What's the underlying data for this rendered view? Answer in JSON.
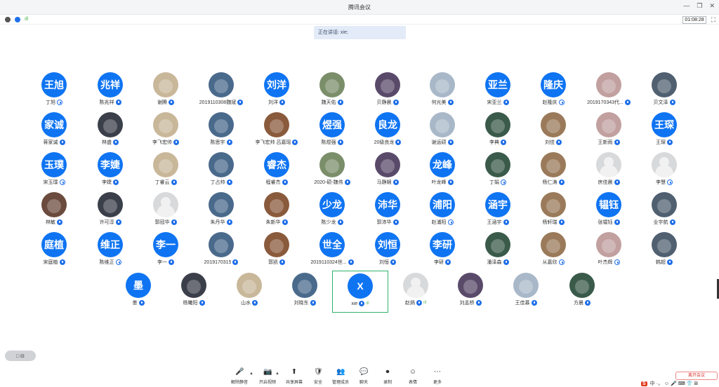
{
  "window": {
    "title": "腾讯会议"
  },
  "toolbar": {
    "time": "01:08:28"
  },
  "speaking": {
    "text": "正在讲话: xie;"
  },
  "colors": {
    "accent": "#0f74f2",
    "selected_border": "#2fb26b"
  },
  "participants": [
    {
      "kind": "blue",
      "avatar": "王旭",
      "name": "丁旭",
      "mic": "off"
    },
    {
      "kind": "blue",
      "avatar": "兆祥",
      "name": "陈兆祥",
      "mic": "on"
    },
    {
      "kind": "photo",
      "avatar": "",
      "name": "谢腾",
      "mic": "on"
    },
    {
      "kind": "photo",
      "avatar": "",
      "name": "2019110308魏斌",
      "mic": "on"
    },
    {
      "kind": "blue",
      "avatar": "刘洋",
      "name": "刘洋",
      "mic": "on"
    },
    {
      "kind": "photo",
      "avatar": "",
      "name": "魏天佑",
      "mic": "on"
    },
    {
      "kind": "photo",
      "avatar": "",
      "name": "贝静晨",
      "mic": "on"
    },
    {
      "kind": "photo",
      "avatar": "",
      "name": "何光美",
      "mic": "on"
    },
    {
      "kind": "blue",
      "avatar": "亚兰",
      "name": "宋亚兰",
      "mic": "on"
    },
    {
      "kind": "blue",
      "avatar": "隆庆",
      "name": "赵隆庆",
      "mic": "off"
    },
    {
      "kind": "photo",
      "avatar": "",
      "name": "2019170343代...",
      "mic": "on"
    },
    {
      "kind": "photo",
      "avatar": "",
      "name": "贝文泽",
      "mic": "on"
    },
    {
      "kind": "blue",
      "avatar": "家诚",
      "name": "蒋家诚",
      "mic": "on"
    },
    {
      "kind": "photo",
      "avatar": "",
      "name": "林盛",
      "mic": "on"
    },
    {
      "kind": "photo",
      "avatar": "",
      "name": "李飞宏帅",
      "mic": "on"
    },
    {
      "kind": "photo",
      "avatar": "",
      "name": "陈思宇",
      "mic": "on"
    },
    {
      "kind": "photo",
      "avatar": "",
      "name": "李飞宏帅 吕嘉瑶",
      "mic": "on"
    },
    {
      "kind": "blue",
      "avatar": "煜强",
      "name": "陈煜强",
      "mic": "on"
    },
    {
      "kind": "blue",
      "avatar": "良龙",
      "name": "20级良龙",
      "mic": "on"
    },
    {
      "kind": "photo",
      "avatar": "",
      "name": "谢运硕",
      "mic": "on"
    },
    {
      "kind": "photo",
      "avatar": "",
      "name": "李典",
      "mic": "on"
    },
    {
      "kind": "photo",
      "avatar": "",
      "name": "刘佳",
      "mic": "on"
    },
    {
      "kind": "photo",
      "avatar": "",
      "name": "王新雨",
      "mic": "on"
    },
    {
      "kind": "blue",
      "avatar": "王琛",
      "name": "王琛",
      "mic": "on"
    },
    {
      "kind": "blue",
      "avatar": "玉璞",
      "name": "宋玉璞",
      "mic": "off"
    },
    {
      "kind": "blue",
      "avatar": "李婕",
      "name": "李婕",
      "mic": "on"
    },
    {
      "kind": "photo",
      "avatar": "",
      "name": "丁睿云",
      "mic": "on"
    },
    {
      "kind": "photo",
      "avatar": "",
      "name": "丁占帅",
      "mic": "on"
    },
    {
      "kind": "blue",
      "avatar": "睿杰",
      "name": "程睿杰",
      "mic": "on"
    },
    {
      "kind": "photo",
      "avatar": "",
      "name": "2020-硕-魏伟",
      "mic": "on"
    },
    {
      "kind": "photo",
      "avatar": "",
      "name": "马静娴",
      "mic": "on"
    },
    {
      "kind": "blue",
      "avatar": "龙峰",
      "name": "叶龙峰",
      "mic": "on"
    },
    {
      "kind": "photo",
      "avatar": "",
      "name": "丁娟",
      "mic": "off"
    },
    {
      "kind": "photo",
      "avatar": "",
      "name": "杨仁涛",
      "mic": "on"
    },
    {
      "kind": "grey",
      "avatar": "",
      "name": "房佳晨",
      "mic": "on"
    },
    {
      "kind": "grey",
      "avatar": "",
      "name": "李慧",
      "mic": "off"
    },
    {
      "kind": "photo",
      "avatar": "",
      "name": "林敏",
      "mic": "on"
    },
    {
      "kind": "photo",
      "avatar": "",
      "name": "许可淳",
      "mic": "on"
    },
    {
      "kind": "grey",
      "avatar": "",
      "name": "郭冠华",
      "mic": "on"
    },
    {
      "kind": "photo",
      "avatar": "",
      "name": "朱丹华",
      "mic": "on"
    },
    {
      "kind": "photo",
      "avatar": "",
      "name": "朱新华",
      "mic": "on"
    },
    {
      "kind": "blue",
      "avatar": "少龙",
      "name": "陈少龙",
      "mic": "on"
    },
    {
      "kind": "blue",
      "avatar": "沛华",
      "name": "郭沛华",
      "mic": "on"
    },
    {
      "kind": "blue",
      "avatar": "浦阳",
      "name": "赵浦阳",
      "mic": "off"
    },
    {
      "kind": "blue",
      "avatar": "涵宇",
      "name": "王涵宇",
      "mic": "on"
    },
    {
      "kind": "photo",
      "avatar": "",
      "name": "杨轩瑞",
      "mic": "on"
    },
    {
      "kind": "blue",
      "avatar": "韫钰",
      "name": "张韫钰",
      "mic": "on"
    },
    {
      "kind": "photo",
      "avatar": "",
      "name": "业宇航",
      "mic": "on"
    },
    {
      "kind": "blue",
      "avatar": "庭植",
      "name": "宋庭植",
      "mic": "on"
    },
    {
      "kind": "blue",
      "avatar": "维正",
      "name": "陈维正",
      "mic": "off"
    },
    {
      "kind": "blue",
      "avatar": "李一",
      "name": "李一",
      "mic": "on"
    },
    {
      "kind": "photo",
      "avatar": "",
      "name": "2019170315",
      "mic": "on"
    },
    {
      "kind": "photo",
      "avatar": "",
      "name": "郭凯",
      "mic": "on"
    },
    {
      "kind": "blue",
      "avatar": "世全",
      "name": "2019110324世...",
      "mic": "on"
    },
    {
      "kind": "blue",
      "avatar": "刘恒",
      "name": "刘恒",
      "mic": "on"
    },
    {
      "kind": "blue",
      "avatar": "李研",
      "name": "李研",
      "mic": "on"
    },
    {
      "kind": "photo",
      "avatar": "",
      "name": "潘泽森",
      "mic": "on"
    },
    {
      "kind": "photo",
      "avatar": "",
      "name": "从嘉欣",
      "mic": "off"
    },
    {
      "kind": "photo",
      "avatar": "",
      "name": "叶杰辉",
      "mic": "off"
    },
    {
      "kind": "photo",
      "avatar": "",
      "name": "韩超",
      "mic": "on"
    },
    {
      "kind": "blue",
      "avatar": "墨",
      "name": "墨",
      "mic": "on"
    },
    {
      "kind": "photo",
      "avatar": "",
      "name": "杨曦阳",
      "mic": "on"
    },
    {
      "kind": "photo",
      "avatar": "",
      "name": "山水",
      "mic": "on"
    },
    {
      "kind": "photo",
      "avatar": "",
      "name": "刘晓东",
      "mic": "on"
    },
    {
      "kind": "blue",
      "avatar": "X",
      "name": "xie",
      "mic": "on",
      "selected": true,
      "bars": true
    },
    {
      "kind": "grey",
      "avatar": "",
      "name": "赵炳",
      "mic": "on",
      "bars": true
    },
    {
      "kind": "photo",
      "avatar": "",
      "name": "刘孟桥",
      "mic": "on"
    },
    {
      "kind": "photo",
      "avatar": "",
      "name": "王佳慕",
      "mic": "on"
    },
    {
      "kind": "photo",
      "avatar": "",
      "name": "方晨",
      "mic": "on"
    }
  ],
  "bottom_bar": {
    "items": [
      {
        "icon": "microphone-icon",
        "label": "解除静音"
      },
      {
        "icon": "camera-icon",
        "label": "开启视频"
      },
      {
        "icon": "share-screen-icon",
        "label": "共享屏幕"
      },
      {
        "icon": "security-icon",
        "label": "安全"
      },
      {
        "icon": "participants-icon",
        "label": "管理成员"
      },
      {
        "icon": "chat-icon",
        "label": "聊天"
      },
      {
        "icon": "record-icon",
        "label": "录制"
      },
      {
        "icon": "reaction-icon",
        "label": "表情"
      },
      {
        "icon": "more-icon",
        "label": "更多"
      }
    ],
    "end_meeting": "离开会议"
  },
  "leftpill": {
    "label": "□ ⊟"
  },
  "tray": {
    "ime": "S",
    "text": "中 ·， ☺ 🎤 ⌨ 👕 ⊞"
  }
}
